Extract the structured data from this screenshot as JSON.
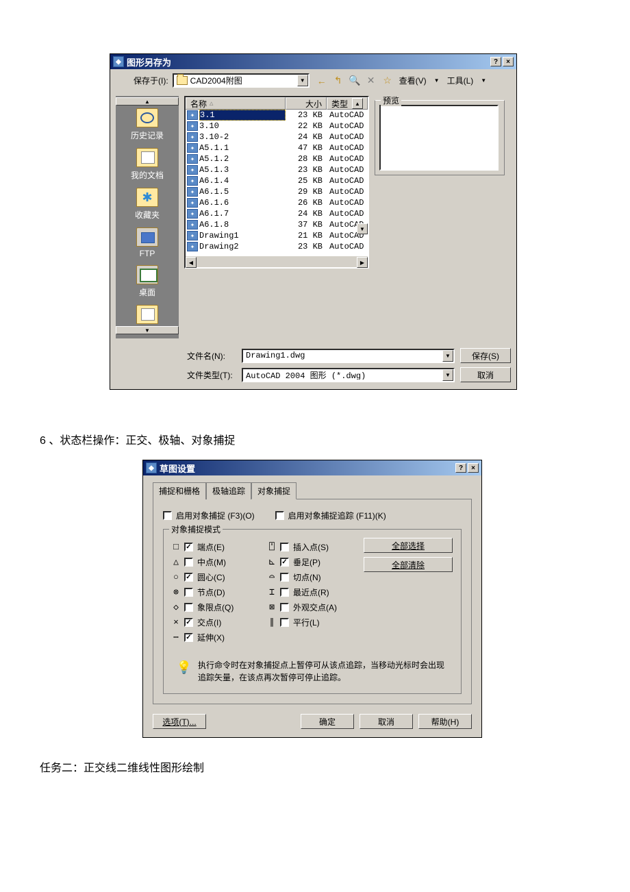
{
  "save_as": {
    "title": "图形另存为",
    "save_in_label": "保存于(I):",
    "folder": "CAD2004附图",
    "toolbar": {
      "back": "←",
      "up": "↰",
      "search": "🔍",
      "delete": "✕",
      "new_folder": "☆",
      "view_label": "查看(V)",
      "tools_label": "工具(L)"
    },
    "places": [
      "历史记录",
      "我的文档",
      "收藏夹",
      "FTP",
      "桌面"
    ],
    "columns": {
      "name": "名称",
      "size": "大小",
      "type": "类型"
    },
    "files": [
      {
        "name": "3.1",
        "size": "23 KB",
        "type": "AutoCAD",
        "selected": true
      },
      {
        "name": "3.10",
        "size": "22 KB",
        "type": "AutoCAD"
      },
      {
        "name": "3.10-2",
        "size": "24 KB",
        "type": "AutoCAD"
      },
      {
        "name": "A5.1.1",
        "size": "47 KB",
        "type": "AutoCAD"
      },
      {
        "name": "A5.1.2",
        "size": "28 KB",
        "type": "AutoCAD"
      },
      {
        "name": "A5.1.3",
        "size": "23 KB",
        "type": "AutoCAD"
      },
      {
        "name": "A6.1.4",
        "size": "25 KB",
        "type": "AutoCAD"
      },
      {
        "name": "A6.1.5",
        "size": "29 KB",
        "type": "AutoCAD"
      },
      {
        "name": "A6.1.6",
        "size": "26 KB",
        "type": "AutoCAD"
      },
      {
        "name": "A6.1.7",
        "size": "24 KB",
        "type": "AutoCAD"
      },
      {
        "name": "A6.1.8",
        "size": "37 KB",
        "type": "AutoCAD"
      },
      {
        "name": "Drawing1",
        "size": "21 KB",
        "type": "AutoCAD"
      },
      {
        "name": "Drawing2",
        "size": "23 KB",
        "type": "AutoCAD"
      }
    ],
    "preview_label": "预览",
    "filename_label": "文件名(N):",
    "filename_value": "Drawing1.dwg",
    "filetype_label": "文件类型(T):",
    "filetype_value": "AutoCAD 2004 图形 (*.dwg)",
    "save_btn": "保存(S)",
    "cancel_btn": "取消"
  },
  "doc": {
    "line1": "6 、状态栏操作：正交、极轴、对象捕捉",
    "line2": "任务二：正交线二维线性图形绘制"
  },
  "draft": {
    "title": "草图设置",
    "tabs": [
      "捕捉和栅格",
      "极轴追踪",
      "对象捕捉"
    ],
    "active_tab": 2,
    "enable_osnap_label": "启用对象捕捉 (F3)(O)",
    "enable_osnap_checked": false,
    "enable_track_label": "启用对象捕捉追踪 (F11)(K)",
    "enable_track_checked": false,
    "group_label": "对象捕捉模式",
    "left": [
      {
        "sym": "□",
        "label": "端点(E)",
        "checked": true
      },
      {
        "sym": "△",
        "label": "中点(M)",
        "checked": false
      },
      {
        "sym": "○",
        "label": "圆心(C)",
        "checked": true
      },
      {
        "sym": "⊗",
        "label": "节点(D)",
        "checked": false
      },
      {
        "sym": "◇",
        "label": "象限点(Q)",
        "checked": false
      },
      {
        "sym": "×",
        "label": "交点(I)",
        "checked": true
      },
      {
        "sym": "⋯",
        "label": "延伸(X)",
        "checked": true
      }
    ],
    "right": [
      {
        "sym": "⍞",
        "label": "插入点(S)",
        "checked": false
      },
      {
        "sym": "⊾",
        "label": "垂足(P)",
        "checked": true
      },
      {
        "sym": "⌓",
        "label": "切点(N)",
        "checked": false
      },
      {
        "sym": "⌶",
        "label": "最近点(R)",
        "checked": false
      },
      {
        "sym": "⊠",
        "label": "外观交点(A)",
        "checked": false
      },
      {
        "sym": "∥",
        "label": "平行(L)",
        "checked": false
      }
    ],
    "select_all": "全部选择",
    "clear_all": "全部清除",
    "hint": "执行命令时在对象捕捉点上暂停可从该点追踪，当移动光标时会出现追踪矢量，在该点再次暂停可停止追踪。",
    "options_btn": "选项(T)...",
    "ok_btn": "确定",
    "cancel_btn": "取消",
    "help_btn": "帮助(H)"
  }
}
